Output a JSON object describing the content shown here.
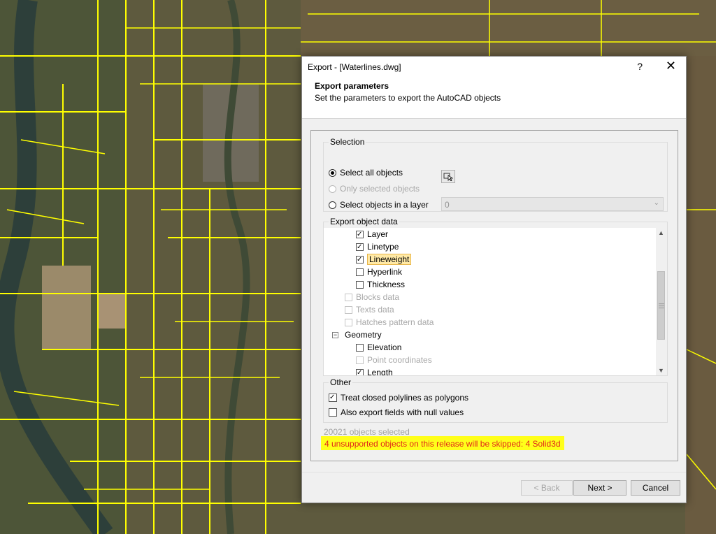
{
  "dialog": {
    "title": "Export - [Waterlines.dwg]",
    "help_label": "?",
    "close_label": "✕",
    "header_title": "Export parameters",
    "header_subtitle": "Set the parameters to export the AutoCAD objects"
  },
  "selection": {
    "group_label": "Selection",
    "options": [
      {
        "label": "Select all objects",
        "selected": true,
        "enabled": true
      },
      {
        "label": "Only selected objects",
        "selected": false,
        "enabled": false
      },
      {
        "label": "Select objects in a layer",
        "selected": false,
        "enabled": true
      }
    ],
    "layer_value": "0",
    "pick_icon": "select-objects-icon"
  },
  "export_data": {
    "group_label": "Export object data",
    "items": [
      {
        "label": "Layer",
        "checked": true,
        "enabled": true
      },
      {
        "label": "Linetype",
        "checked": true,
        "enabled": true
      },
      {
        "label": "Lineweight",
        "checked": true,
        "enabled": true,
        "highlighted": true
      },
      {
        "label": "Hyperlink",
        "checked": false,
        "enabled": true
      },
      {
        "label": "Thickness",
        "checked": false,
        "enabled": true
      },
      {
        "label": "Blocks data",
        "checked": false,
        "enabled": false
      },
      {
        "label": "Texts data",
        "checked": false,
        "enabled": false
      },
      {
        "label": "Hatches pattern data",
        "checked": false,
        "enabled": false
      },
      {
        "label": "Geometry",
        "expander": "−"
      },
      {
        "label": "Elevation",
        "checked": false,
        "enabled": true
      },
      {
        "label": "Point coordinates",
        "checked": false,
        "enabled": false
      },
      {
        "label": "Length",
        "checked": true,
        "enabled": true
      }
    ]
  },
  "other": {
    "group_label": "Other",
    "options": [
      {
        "label": "Treat closed polylines as polygons",
        "checked": true
      },
      {
        "label": "Also export fields with null values",
        "checked": false
      }
    ]
  },
  "status": {
    "count_text": "20021 objects selected",
    "warning_text": "4 unsupported objects on this release will be skipped: 4 Solid3d"
  },
  "buttons": {
    "back": "< Back",
    "next": "Next >",
    "cancel": "Cancel"
  },
  "colors": {
    "map_lines": "#ffff00",
    "warning_bg": "#ffff1a",
    "warning_text": "#e0261a",
    "highlight_bg": "#ffe9a6"
  }
}
